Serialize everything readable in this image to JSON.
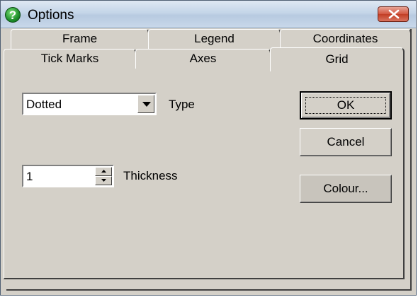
{
  "window": {
    "title": "Options"
  },
  "tabs": {
    "back": [
      "Frame",
      "Legend",
      "Coordinates"
    ],
    "front": [
      "Tick Marks",
      "Axes",
      "Grid"
    ],
    "active": "Grid"
  },
  "grid": {
    "type_value": "Dotted",
    "type_label": "Type",
    "thickness_value": "1",
    "thickness_label": "Thickness"
  },
  "buttons": {
    "ok": "OK",
    "cancel": "Cancel",
    "colour": "Colour..."
  },
  "colors": {
    "title_gradient": "#c4d5e8",
    "close_button": "#c94a33",
    "face": "#d4d0c8"
  }
}
